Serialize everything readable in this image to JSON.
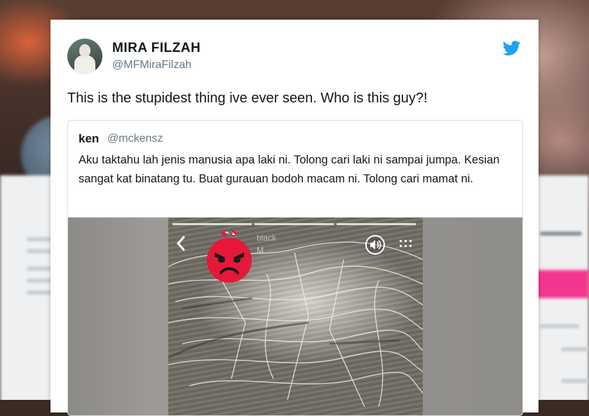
{
  "tweet": {
    "author_name": "MIRA FILZAH",
    "author_handle": "@MFMiraFilzah",
    "text": "This is the stupidest thing ive ever seen. Who is this guy?!"
  },
  "quoted_tweet": {
    "author_name": "ken",
    "author_handle": "@mckensz",
    "text": "Aku taktahu lah jenis manusia apa laki ni. Tolong cari laki ni sampai jumpa. Kesian sangat kat binatang tu. Buat gurauan bodoh macam ni. Tolong cari mamat ni.",
    "video": {
      "overlay_username": "black",
      "overlay_time": "M"
    }
  },
  "icons": {
    "brand": "twitter-bird-icon",
    "back": "chevron-left-icon",
    "volume": "volume-icon",
    "more": "more-icon",
    "censor": "angry-face-emoji-icon"
  },
  "colors": {
    "twitter_blue": "#1da1f2",
    "name_text": "#14171a",
    "handle_text": "#657786",
    "emoji_red": "#e5183a"
  }
}
